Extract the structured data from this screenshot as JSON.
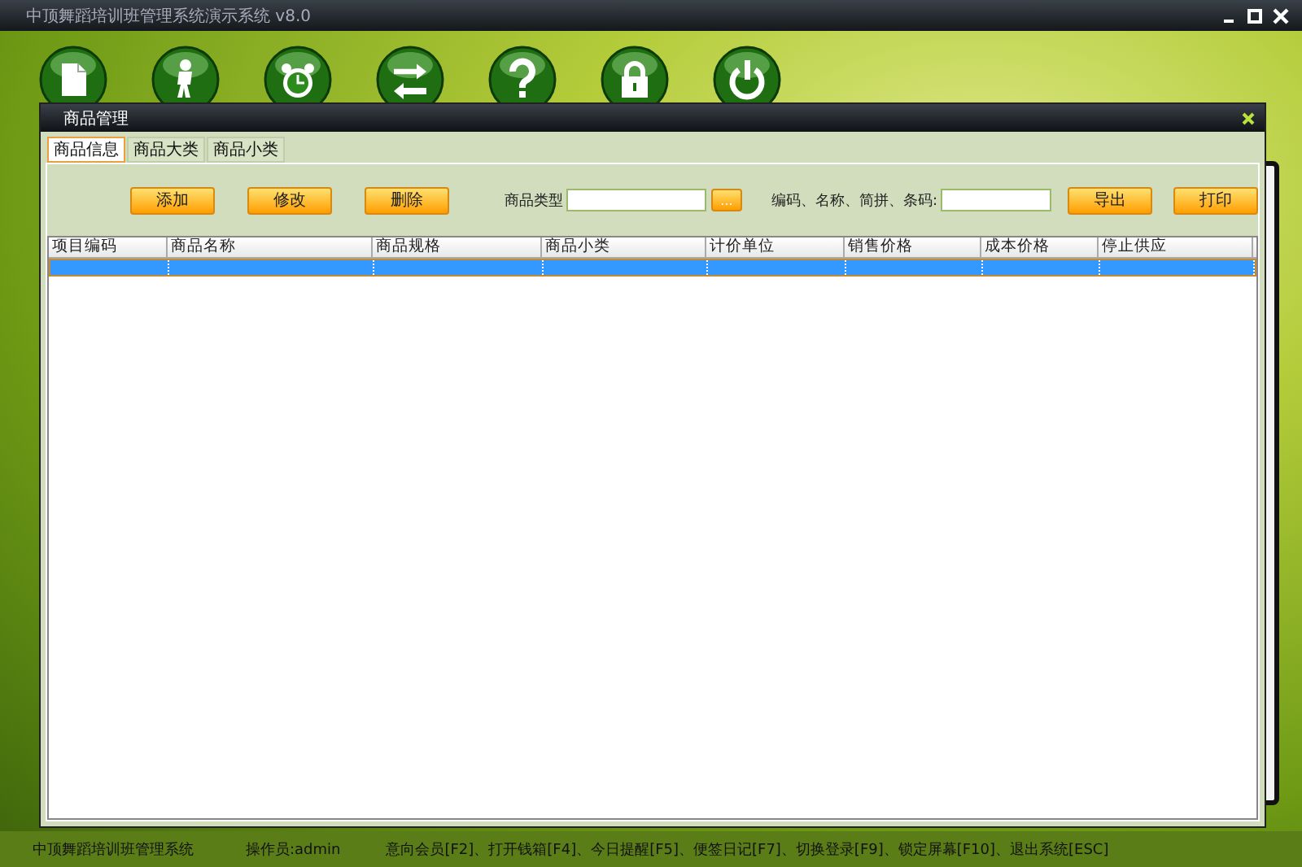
{
  "window": {
    "title": "中顶舞蹈培训班管理系统演示系统  v8.0"
  },
  "toolbar": [
    {
      "kind": "document"
    },
    {
      "kind": "person"
    },
    {
      "kind": "clock"
    },
    {
      "kind": "swap"
    },
    {
      "kind": "help"
    },
    {
      "kind": "lock"
    },
    {
      "kind": "power"
    }
  ],
  "dialog": {
    "title": "商品管理",
    "tabs": [
      {
        "label": "商品信息",
        "selected": true
      },
      {
        "label": "商品大类",
        "selected": false
      },
      {
        "label": "商品小类",
        "selected": false
      }
    ],
    "buttons": [
      "添加",
      "修改",
      "删除"
    ],
    "category": {
      "label": "商品类型",
      "browse": "..."
    },
    "search": {
      "label": "编码、名称、简拼、条码:"
    },
    "actions": [
      "导出",
      "打印"
    ],
    "table": {
      "columns": [
        "项目编码",
        "商品名称",
        "商品规格",
        "商品小类",
        "计价单位",
        "销售价格",
        "成本价格",
        "停止供应"
      ],
      "rows": [
        {
          "selected": true
        }
      ]
    }
  },
  "status_bar": {
    "app": "中顶舞蹈培训班管理系统",
    "operator": "操作员:admin",
    "shortcuts": "意向会员[F2]、打开钱箱[F4]、今日提醒[F5]、便签日记[F7]、切换登录[F9]、锁定屏幕[F10]、退出系统[ESC]"
  }
}
